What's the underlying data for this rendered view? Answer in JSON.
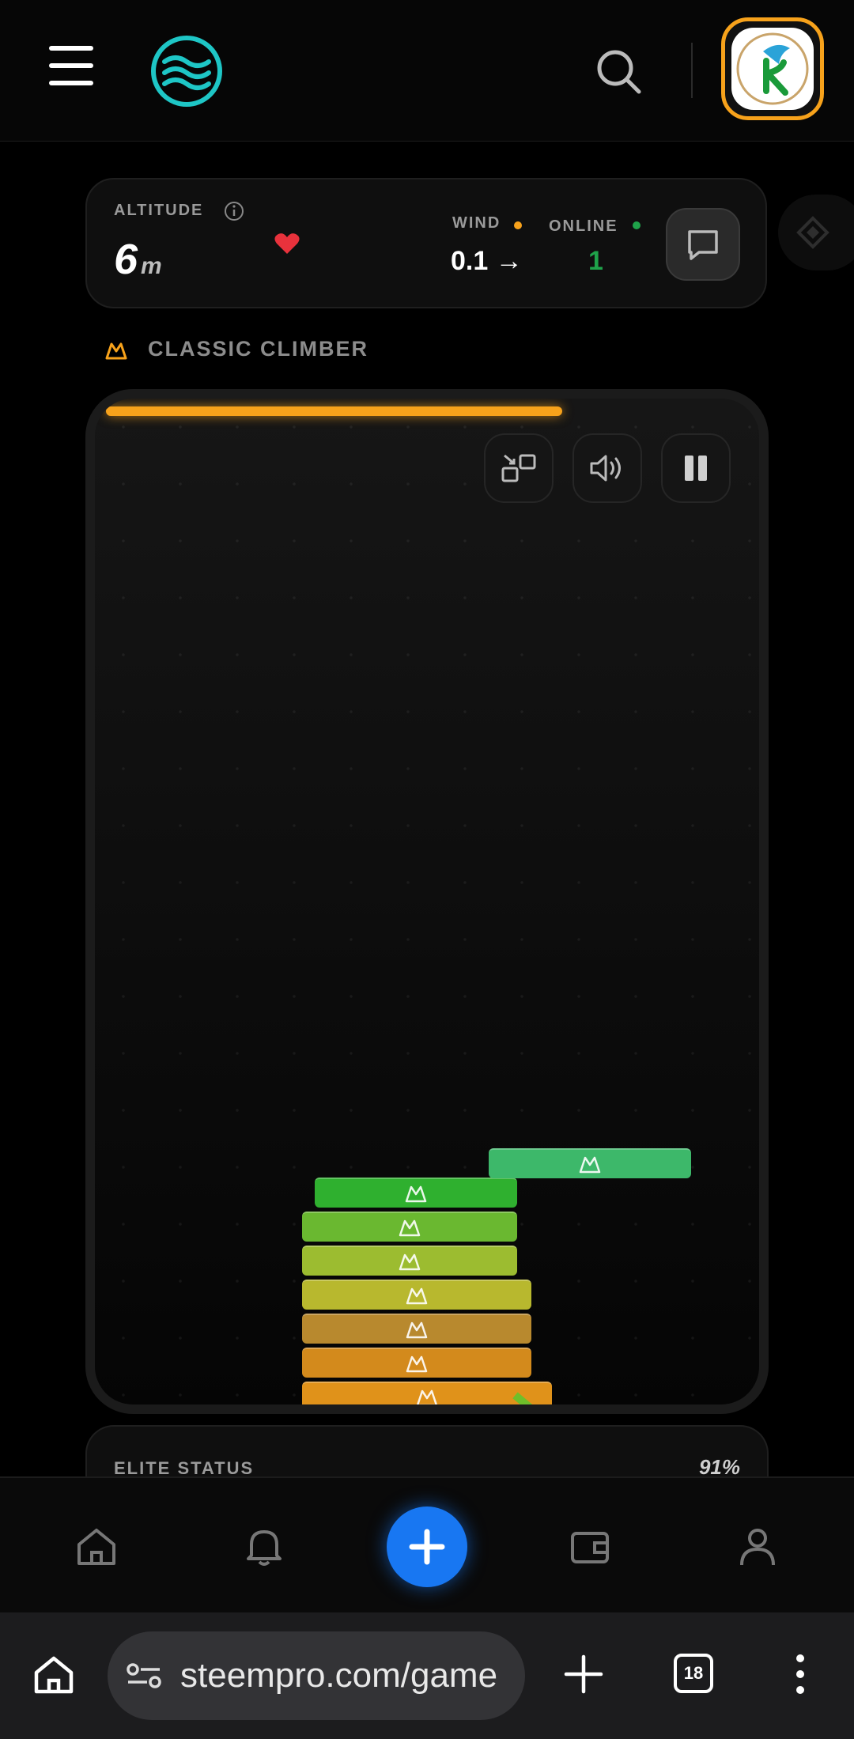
{
  "header": {
    "menu_icon": "hamburger-icon",
    "logo_icon": "steem-waves-logo",
    "search_icon": "search-icon",
    "avatar_icon": "user-avatar-bird-r"
  },
  "stats": {
    "altitude_label": "ALTITUDE",
    "altitude_value": "6",
    "altitude_unit": "m",
    "wind_label": "WIND",
    "wind_value": "0.1 →",
    "online_label": "ONLINE",
    "online_value": "1",
    "chat_icon": "chat-bubble-icon"
  },
  "mode": {
    "label": "CLASSIC CLIMBER",
    "icon": "mountain-icon"
  },
  "game": {
    "progress": 0.71,
    "controls": [
      "swap-screen-icon",
      "volume-icon",
      "pause-icon"
    ],
    "colors": {
      "accent": "#f7a21b",
      "moving_block": "#3db86a",
      "stack": [
        "#e0921a",
        "#d38a1c",
        "#b8892e",
        "#b8b82e",
        "#9cbc30",
        "#6ab830",
        "#2fb02f"
      ]
    }
  },
  "elite": {
    "label": "ELITE STATUS",
    "value": "91%"
  },
  "bottom_nav": {
    "items": [
      "home-icon",
      "bell-icon",
      "create-plus-icon",
      "wallet-icon",
      "profile-icon"
    ],
    "accent": "#1877f2"
  },
  "browser": {
    "url": "steempro.com/game",
    "tab_count": "18"
  }
}
